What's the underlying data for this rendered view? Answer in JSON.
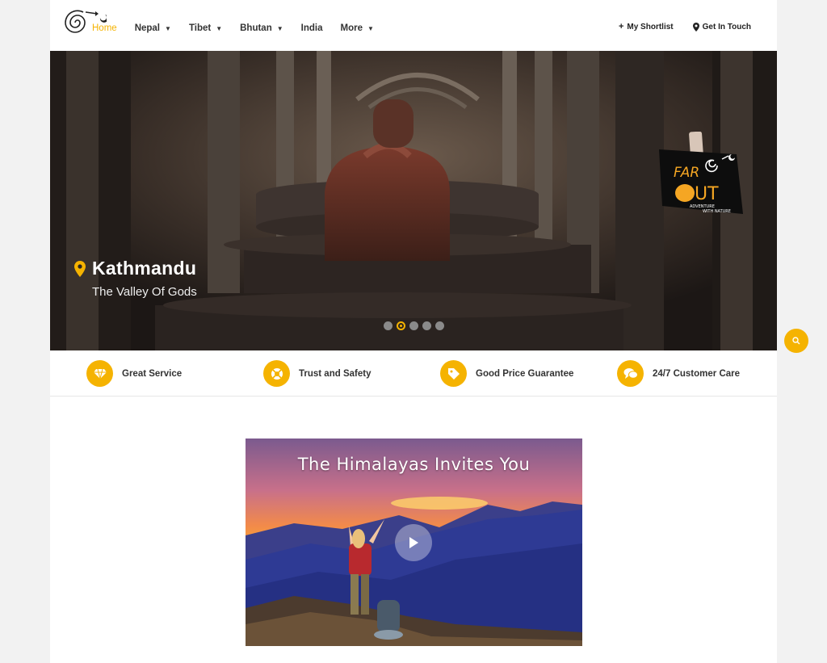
{
  "colors": {
    "accent": "#f5b301",
    "text": "#333333",
    "page_bg": "#f2f2f2"
  },
  "nav": {
    "items": [
      {
        "label": "Home",
        "active": true,
        "dropdown": false
      },
      {
        "label": "Nepal",
        "active": false,
        "dropdown": true
      },
      {
        "label": "Tibet",
        "active": false,
        "dropdown": true
      },
      {
        "label": "Bhutan",
        "active": false,
        "dropdown": true
      },
      {
        "label": "India",
        "active": false,
        "dropdown": false
      },
      {
        "label": "More",
        "active": false,
        "dropdown": true
      }
    ],
    "shortlist_label": "My Shortlist",
    "contact_label": "Get In Touch"
  },
  "hero": {
    "title": "Kathmandu",
    "subtitle": "The Valley Of Gods",
    "slides": 5,
    "active_slide": 2
  },
  "features": [
    {
      "label": "Great Service",
      "icon": "diamond-icon"
    },
    {
      "label": "Trust and Safety",
      "icon": "lifebuoy-icon"
    },
    {
      "label": "Good Price Guarantee",
      "icon": "tag-icon"
    },
    {
      "label": "24/7 Customer Care",
      "icon": "chat-icon"
    }
  ],
  "video": {
    "title": "The Himalayas Invites You"
  }
}
